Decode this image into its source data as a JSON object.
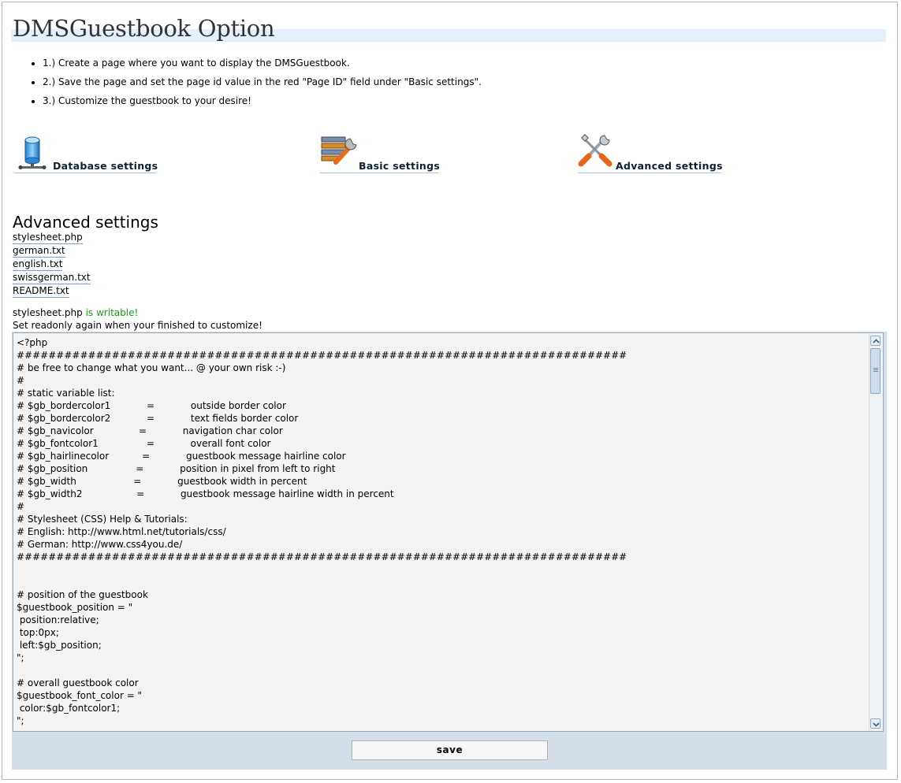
{
  "page": {
    "title": "DMSGuestbook Option"
  },
  "steps": [
    "1.) Create a page where you want to display the DMSGuestbook.",
    "2.) Save the page and set the page id value in the red \"Page ID\" field under \"Basic settings\".",
    "3.) Customize the guestbook to your desire!"
  ],
  "nav": {
    "database": {
      "label": "Database settings",
      "icon": "database-server-icon"
    },
    "basic": {
      "label": "Basic settings",
      "icon": "settings-wrench-icon"
    },
    "advanced": {
      "label": "Advanced settings",
      "icon": "tools-icon"
    }
  },
  "advanced": {
    "heading": "Advanced settings",
    "files": [
      "stylesheet.php",
      "german.txt",
      "english.txt",
      "swissgerman.txt",
      "README.txt"
    ],
    "status_file": "stylesheet.php",
    "status_ok": "is writable!",
    "status_note": "Set readonly again when your finished to customize!"
  },
  "editor": {
    "content": "<?php\n#############################################################################\n# be free to change what you want... @ your own risk :-)\n#\n# static variable list:\n# $gb_bordercolor1            =            outside border color\n# $gb_bordercolor2            =            text fields border color\n# $gb_navicolor               =            navigation char color\n# $gb_fontcolor1                =            overall font color\n# $gb_hairlinecolor           =            guestbook message hairline color\n# $gb_position                =            position in pixel from left to right\n# $gb_width                   =            guestbook width in percent\n# $gb_width2                  =            guestbook message hairline width in percent\n#\n# Stylesheet (CSS) Help & Tutorials:\n# English: http://www.html.net/tutorials/css/\n# German: http://www.css4you.de/\n#############################################################################\n\n\n# position of the guestbook\n$guestbook_position = \"\n position:relative;\n top:0px;\n left:$gb_position;\n\";\n\n# overall guestbook color\n$guestbook_font_color = \"\n color:$gb_fontcolor1;\n\";",
    "save_label": "save"
  },
  "colors": {
    "title_band": "#e4f0fb",
    "writable_green": "#1a9a1a",
    "editor_bg": "#f3f3f3",
    "panel_bg": "#d4dee8"
  }
}
